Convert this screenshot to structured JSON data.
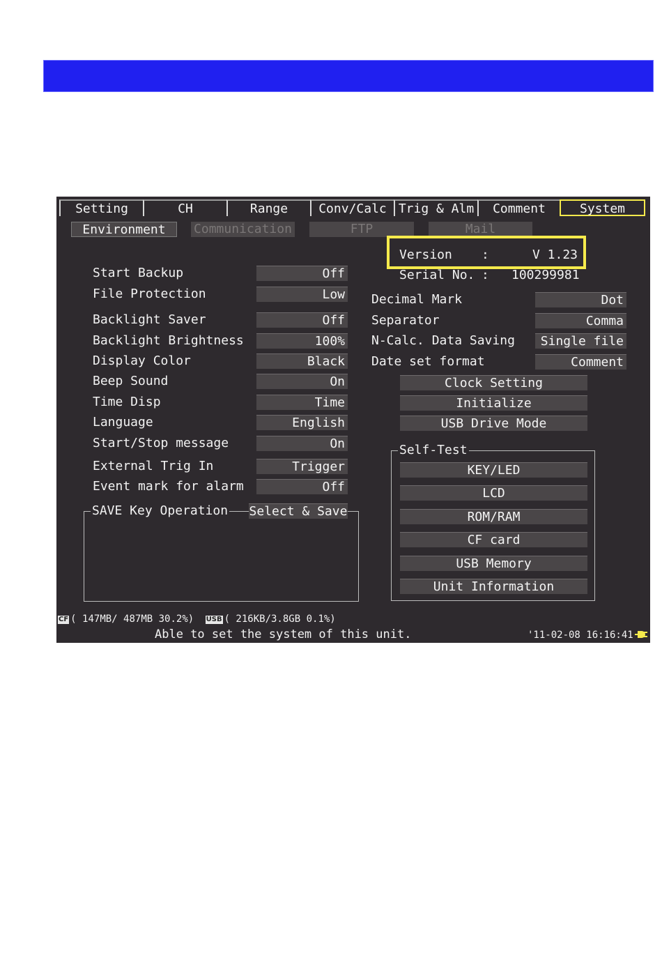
{
  "tabs": [
    {
      "label": "Setting"
    },
    {
      "label": "CH"
    },
    {
      "label": "Range"
    },
    {
      "label": "Conv/Calc"
    },
    {
      "label": "Trig & Alm"
    },
    {
      "label": "Comment"
    },
    {
      "label": "System"
    }
  ],
  "subtabs": [
    {
      "label": "Environment"
    },
    {
      "label": "Communication"
    },
    {
      "label": "FTP"
    },
    {
      "label": "Mail"
    }
  ],
  "version": {
    "label": "Version",
    "colon": ":",
    "value": "V 1.23"
  },
  "serial": {
    "label": "Serial No.",
    "colon": ":",
    "value": "100299981"
  },
  "left_settings": [
    {
      "label": "Start Backup",
      "value": "Off"
    },
    {
      "label": "File Protection",
      "value": "Low"
    },
    {
      "label": "Backlight Saver",
      "value": "Off"
    },
    {
      "label": "Backlight Brightness",
      "value": "100%"
    },
    {
      "label": "Display Color",
      "value": "Black"
    },
    {
      "label": "Beep Sound",
      "value": "On"
    },
    {
      "label": "Time Disp",
      "value": "Time"
    },
    {
      "label": "Language",
      "value": "English"
    },
    {
      "label": "Start/Stop message",
      "value": "On"
    },
    {
      "label": "External Trig In",
      "value": "Trigger"
    },
    {
      "label": "Event mark for alarm",
      "value": "Off"
    }
  ],
  "save_key": {
    "label": "SAVE Key Operation",
    "value": "Select & Save"
  },
  "right_settings": [
    {
      "label": "Decimal Mark",
      "value": "Dot"
    },
    {
      "label": "Separator",
      "value": "Comma"
    },
    {
      "label": "N-Calc. Data Saving",
      "value": "Single file"
    },
    {
      "label": "Date set format",
      "value": "Comment"
    }
  ],
  "actions": [
    {
      "label": "Clock Setting"
    },
    {
      "label": "Initialize"
    },
    {
      "label": "USB Drive Mode"
    }
  ],
  "self_test": {
    "title": "Self-Test",
    "buttons": [
      {
        "label": "KEY/LED"
      },
      {
        "label": "LCD"
      },
      {
        "label": "ROM/RAM"
      },
      {
        "label": "CF card"
      },
      {
        "label": "USB Memory"
      },
      {
        "label": "Unit Information"
      }
    ]
  },
  "status": {
    "cf_badge": "CF",
    "cf_text": "( 147MB/ 487MB 30.2%)",
    "usb_badge": "USB",
    "usb_text": "( 216KB/3.8GB  0.1%)",
    "message": "Able to set the system of this unit.",
    "datetime": "'11-02-08 16:16:41"
  },
  "colors": {
    "banner": "#2020f0",
    "screen_bg": "#2e2a2e",
    "highlight": "#f5ea4c"
  }
}
